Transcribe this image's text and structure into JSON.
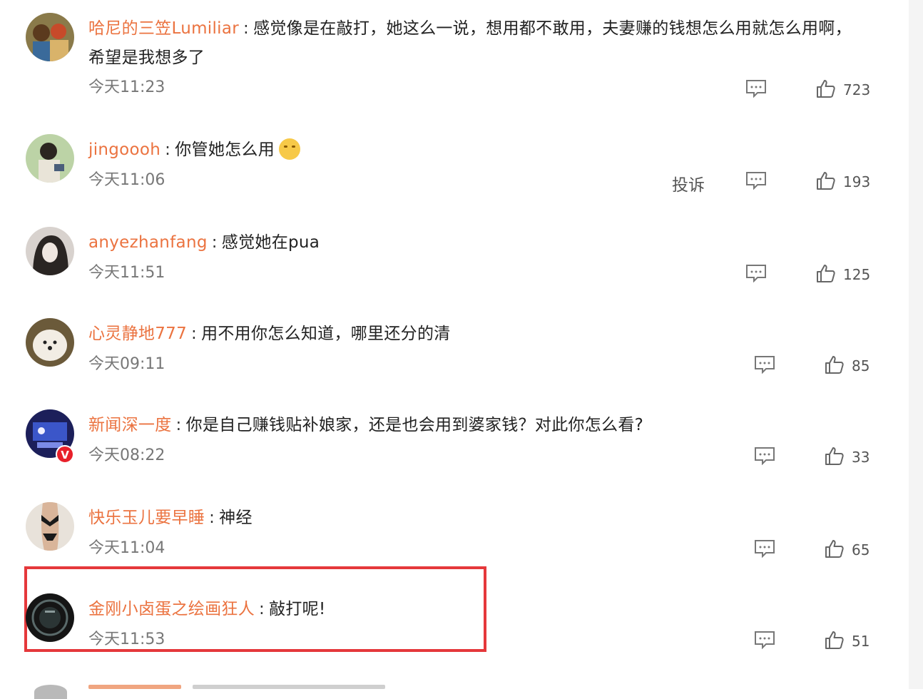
{
  "comments": [
    {
      "username": "哈尼的三笠Lumiliar",
      "separator": ":",
      "text": "感觉像是在敲打，她这么一说，想用都不敢用，夫妻赚的钱想怎么用就怎么用啊，",
      "text_line2": "希望是我想多了",
      "time": "今天11:23",
      "likes": "723",
      "avatar_icon": "anime-couple-avatar"
    },
    {
      "username": "jingoooh",
      "separator": ":",
      "text": "你管她怎么用",
      "emoji_icon": "shush-emoji",
      "time": "今天11:06",
      "complain_label": "投诉",
      "likes": "193",
      "avatar_icon": "anime-boy-phone-avatar"
    },
    {
      "username": "anyezhanfang",
      "separator": ":",
      "text": "感觉她在pua",
      "time": "今天11:51",
      "likes": "125",
      "avatar_icon": "girl-portrait-avatar"
    },
    {
      "username": "心灵静地777",
      "separator": ":",
      "text": "用不用你怎么知道，哪里还分的清",
      "time": "今天09:11",
      "likes": "85",
      "avatar_icon": "pomeranian-dog-avatar"
    },
    {
      "username": "新闻深一度",
      "separator": ":",
      "text": "你是自己赚钱贴补娘家，还是也会用到婆家钱？对此你怎么看?",
      "time": "今天08:22",
      "likes": "33",
      "verified_badge": "V",
      "avatar_icon": "news-studio-avatar"
    },
    {
      "username": "快乐玉儿要早睡",
      "separator": ":",
      "text": "神经",
      "time": "今天11:04",
      "likes": "65",
      "avatar_icon": "swimsuit-figure-avatar"
    },
    {
      "username": "金刚小卤蛋之绘画狂人",
      "separator": ":",
      "text": "敲打呢!",
      "time": "今天11:53",
      "likes": "51",
      "highlighted": true,
      "avatar_icon": "dark-round-logo-avatar"
    }
  ],
  "colors": {
    "username": "#eb7340",
    "text": "#222222",
    "time": "#777777",
    "highlight_border": "#e5383b",
    "verified_badge": "#e8202a"
  }
}
